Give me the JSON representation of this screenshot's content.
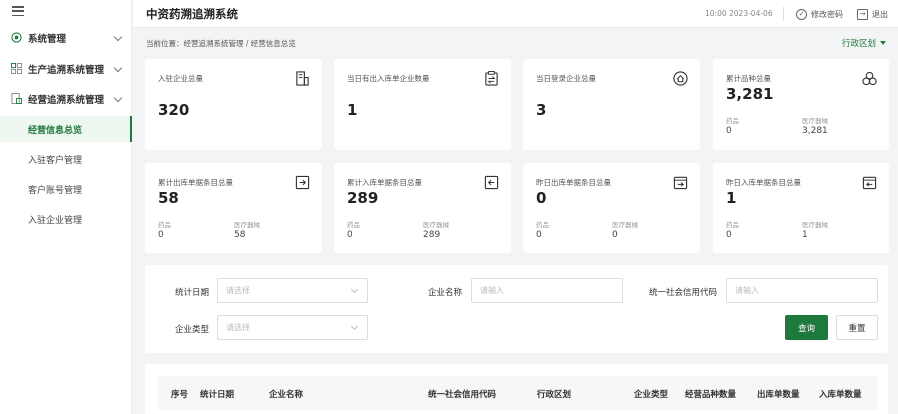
{
  "app": {
    "title": "中资药溯追溯系统"
  },
  "header": {
    "datetime": "10:00 2023-04-06",
    "change_password": "修改密码",
    "logout": "退出"
  },
  "sidebar": {
    "groups": [
      {
        "label": "系统管理"
      },
      {
        "label": "生产追溯系统管理"
      },
      {
        "label": "经营追溯系统管理"
      }
    ],
    "items": [
      {
        "label": "经营信息总览",
        "active": true
      },
      {
        "label": "入驻客户管理"
      },
      {
        "label": "客户账号管理"
      },
      {
        "label": "入驻企业管理"
      }
    ]
  },
  "breadcrumb": {
    "text": "当前位置：经营追溯系统管理 / 经营信息总览"
  },
  "region_selector": {
    "label": "行政区划"
  },
  "stats": [
    {
      "label": "入驻企业总量",
      "value": "320"
    },
    {
      "label": "当日有出入库单企业数量",
      "value": "1"
    },
    {
      "label": "当日登录企业总量",
      "value": "3"
    },
    {
      "label": "累计品种总量",
      "value": "3,281",
      "sub": [
        {
          "label": "药品",
          "value": "0"
        },
        {
          "label": "医疗器械",
          "value": "3,281"
        }
      ]
    },
    {
      "label": "累计出库单据条目总量",
      "value": "58",
      "sub": [
        {
          "label": "药品",
          "value": "0"
        },
        {
          "label": "医疗器械",
          "value": "58"
        }
      ]
    },
    {
      "label": "累计入库单据条目总量",
      "value": "289",
      "sub": [
        {
          "label": "药品",
          "value": "0"
        },
        {
          "label": "医疗器械",
          "value": "289"
        }
      ]
    },
    {
      "label": "昨日出库单据条目总量",
      "value": "0",
      "sub": [
        {
          "label": "药品",
          "value": "0"
        },
        {
          "label": "医疗器械",
          "value": "0"
        }
      ]
    },
    {
      "label": "昨日入库单据条目总量",
      "value": "1",
      "sub": [
        {
          "label": "药品",
          "value": "0"
        },
        {
          "label": "医疗器械",
          "value": "1"
        }
      ]
    }
  ],
  "filters": {
    "stat_date": {
      "label": "统计日期",
      "placeholder": "请选择"
    },
    "company_name": {
      "label": "企业名称",
      "placeholder": "请输入"
    },
    "credit_code": {
      "label": "统一社会信用代码",
      "placeholder": "请输入"
    },
    "company_type": {
      "label": "企业类型",
      "placeholder": "请选择"
    },
    "query_label": "查询",
    "reset_label": "重置"
  },
  "table": {
    "columns": [
      "序号",
      "统计日期",
      "企业名称",
      "统一社会信用代码",
      "行政区划",
      "企业类型",
      "经营品种数量",
      "出库单数量",
      "入库单数量"
    ]
  },
  "colors": {
    "accent": "#1e7a3c"
  }
}
